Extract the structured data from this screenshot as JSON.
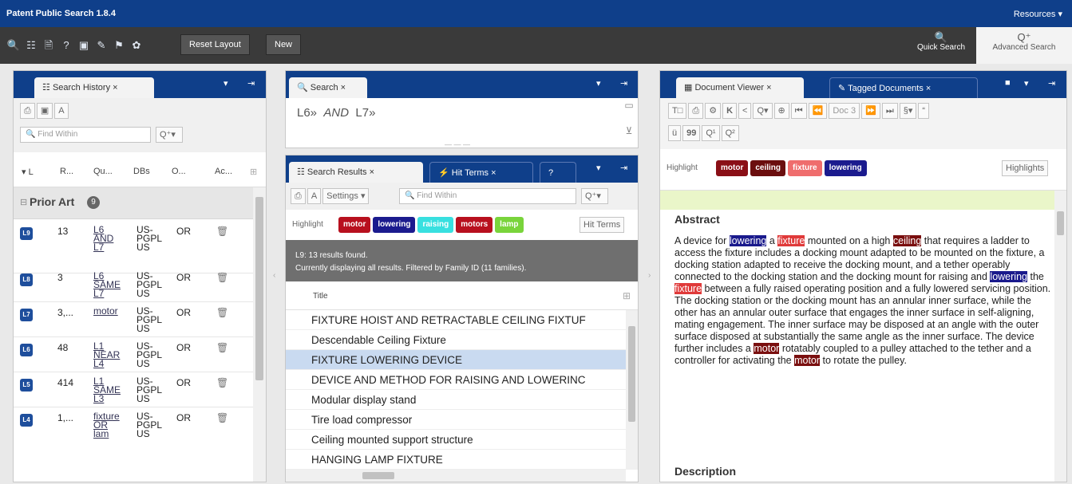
{
  "app": {
    "title": "Patent Public Search 1.8.4",
    "resources": "Resources ▾"
  },
  "toolbar": {
    "icons": [
      "search-icon",
      "search-history-icon",
      "document-icon",
      "help-icon",
      "save-icon",
      "tag-icon",
      "flag-icon",
      "pin-icon"
    ],
    "reset_layout": "Reset Layout",
    "new": "New",
    "quick_search": "Quick Search",
    "advanced_search": "Advanced Search"
  },
  "history": {
    "tab": "Search History",
    "find_placeholder": "Find Within",
    "columns": [
      "▾ L",
      "R...",
      "Qu...",
      "DBs",
      "O...",
      "Ac..."
    ],
    "group": "Prior Art",
    "group_count": "9",
    "rows": [
      {
        "l": "L9",
        "r": "13",
        "q1": "L6",
        "q2": "AND",
        "q3": "L7",
        "db1": "US-",
        "db2": "PGPL",
        "db3": "US",
        "op": "OR"
      },
      {
        "l": "L8",
        "r": "3",
        "q1": "L6",
        "q2": "SAME",
        "q3": "L7",
        "db1": "US-",
        "db2": "PGPL",
        "db3": "US",
        "op": "OR"
      },
      {
        "l": "L7",
        "r": "3,...",
        "q1": "motor",
        "q2": "",
        "q3": "",
        "db1": "US-",
        "db2": "PGPL",
        "db3": "US",
        "op": "OR"
      },
      {
        "l": "L6",
        "r": "48",
        "q1": "L1",
        "q2": "NEAR",
        "q3": "L4",
        "db1": "US-",
        "db2": "PGPL",
        "db3": "US",
        "op": "OR"
      },
      {
        "l": "L5",
        "r": "414",
        "q1": "L1",
        "q2": "SAME",
        "q3": "L3",
        "db1": "US-",
        "db2": "PGPL",
        "db3": "US",
        "op": "OR"
      },
      {
        "l": "L4",
        "r": "1,...",
        "q1": "fixture",
        "q2": "OR",
        "q3": "lam",
        "db1": "US-",
        "db2": "PGPL",
        "db3": "US",
        "op": "OR"
      }
    ]
  },
  "search": {
    "tab": "Search",
    "t1": "L6»",
    "t2": "AND",
    "t3": "L7»"
  },
  "results": {
    "tab": "Search Results",
    "tab2": "Hit Terms",
    "tab3": "?",
    "settings": "Settings",
    "find_placeholder": "Find Within",
    "highlight_label": "Highlight",
    "chips": [
      {
        "label": "motor",
        "color": "#b8101e"
      },
      {
        "label": "lowering",
        "color": "#1b1b8e"
      },
      {
        "label": "raising",
        "color": "#38e0e0"
      },
      {
        "label": "motors",
        "color": "#b8101e"
      },
      {
        "label": "lamp",
        "color": "#79d43b"
      }
    ],
    "hit_terms_btn": "Hit Terms",
    "status1": "L9: 13 results found.",
    "status2": "Currently displaying all results. Filtered by Family ID (11 families).",
    "col_title": "Title",
    "items": [
      "FIXTURE HOIST AND RETRACTABLE CEILING FIXTUF",
      "Descendable Ceiling Fixture",
      "FIXTURE LOWERING DEVICE",
      "DEVICE AND METHOD FOR RAISING AND LOWERINC",
      "Modular display stand",
      "Tire load compressor",
      "Ceiling mounted support structure",
      "HANGING LAMP FIXTURE"
    ]
  },
  "viewer": {
    "tab": "Document Viewer",
    "tab2": "Tagged Documents",
    "doc": "Doc 3",
    "highlight_label": "Highlight",
    "chips": [
      {
        "label": "motor",
        "color": "#8a0f16"
      },
      {
        "label": "ceiling",
        "color": "#6b0e0e"
      },
      {
        "label": "fixture",
        "color": "#ef6d6d"
      },
      {
        "label": "lowering",
        "color": "#1b1b8e"
      }
    ],
    "highlights_btn": "Highlights",
    "abstract_title": "Abstract",
    "description_title": "Description",
    "abs": {
      "p1": "A device for",
      "w1": "lowering",
      "p2": "a",
      "w2": "fixture",
      "p3": "mounted on a high",
      "w3": "ceiling",
      "p4": "that requires a ladder to access the fixture includes a docking mount adapted to be mounted on the fixture, a docking station adapted to receive the docking mount, and a tether operably connected to the docking station and the docking mount for raising and",
      "w4": "lowering",
      "p5": "the",
      "w5": "fixture",
      "p6": "between a fully raised operating position and a fully lowered servicing position. The docking station or the docking mount has an annular inner surface, while the other has an annular outer surface that engages the inner surface in self-aligning, mating engagement. The inner surface may be disposed at an angle with the outer surface disposed at substantially the same angle as the inner surface. The device further includes a",
      "w6": "motor",
      "p7": "rotatably coupled to a pulley attached to the tether and a controller for activating the",
      "w7": "motor",
      "p8": "to rotate the pulley."
    }
  }
}
